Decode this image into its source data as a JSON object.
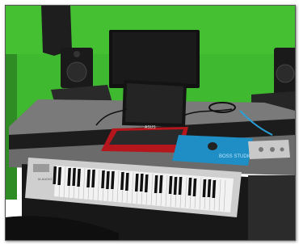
{
  "scene": {
    "wall_color": "#3fb92f",
    "desk_color": "#6b6b6b",
    "laptop_color": "#b5161b",
    "mousepad_color": "#1e8ec4",
    "keyboard_color": "#cfcfcf",
    "cable_accent": "#2a9fd6"
  },
  "laptop": {
    "brand": "ASUS"
  },
  "mousepad": {
    "text": "BOSS STUDIO"
  },
  "keyboard": {
    "brand": "M-AUDIO"
  }
}
